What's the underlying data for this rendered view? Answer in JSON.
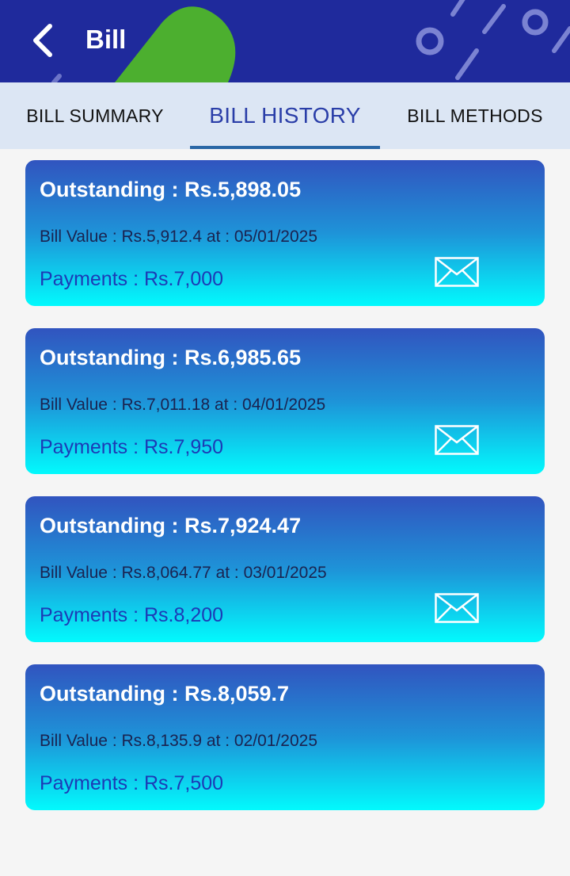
{
  "header": {
    "title": "Bill",
    "back_icon": "back-chevron-icon",
    "colors": {
      "background": "#1f2a9c",
      "accent_green": "#4caf2f"
    }
  },
  "tabs": [
    {
      "label": "BILL SUMMARY",
      "active": false
    },
    {
      "label": "BILL HISTORY",
      "active": true
    },
    {
      "label": "BILL METHODS",
      "active": false
    }
  ],
  "bills": [
    {
      "outstanding": "Outstanding : Rs.5,898.05",
      "bill_value": "Bill Value : Rs.5,912.4 at : 05/01/2025",
      "payments": "Payments : Rs.7,000",
      "has_mail": true
    },
    {
      "outstanding": "Outstanding : Rs.6,985.65",
      "bill_value": "Bill Value : Rs.7,011.18 at : 04/01/2025",
      "payments": "Payments : Rs.7,950",
      "has_mail": true
    },
    {
      "outstanding": "Outstanding : Rs.7,924.47",
      "bill_value": "Bill Value : Rs.8,064.77 at : 03/01/2025",
      "payments": "Payments : Rs.8,200",
      "has_mail": true
    },
    {
      "outstanding": "Outstanding : Rs.8,059.7",
      "bill_value": "Bill Value : Rs.8,135.9 at : 02/01/2025",
      "payments": "Payments : Rs.7,500",
      "has_mail": false
    }
  ]
}
